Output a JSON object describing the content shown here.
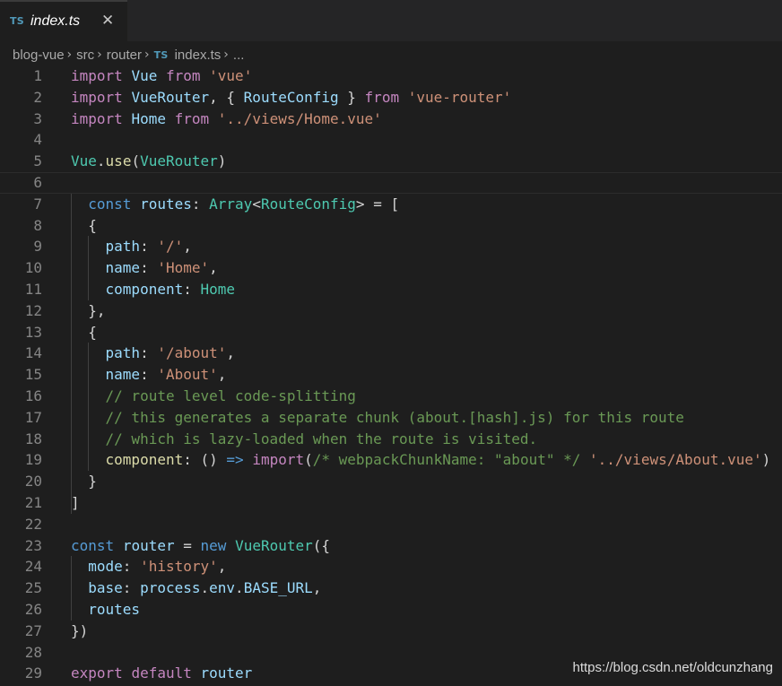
{
  "tab": {
    "language_badge": "TS",
    "title": "index.ts",
    "close_glyph": "✕"
  },
  "breadcrumb": {
    "items": [
      "blog-vue",
      "src",
      "router"
    ],
    "file_badge": "TS",
    "file": "index.ts",
    "ellipsis": "...",
    "separator": "›"
  },
  "editor": {
    "current_line": 6,
    "lines": [
      {
        "n": "1",
        "tokens": [
          [
            "k",
            "import"
          ],
          [
            "p",
            " "
          ],
          [
            "v",
            "Vue"
          ],
          [
            "p",
            " "
          ],
          [
            "k",
            "from"
          ],
          [
            "p",
            " "
          ],
          [
            "s",
            "'vue'"
          ]
        ]
      },
      {
        "n": "2",
        "tokens": [
          [
            "k",
            "import"
          ],
          [
            "p",
            " "
          ],
          [
            "v",
            "VueRouter"
          ],
          [
            "p",
            ", { "
          ],
          [
            "v",
            "RouteConfig"
          ],
          [
            "p",
            " } "
          ],
          [
            "k",
            "from"
          ],
          [
            "p",
            " "
          ],
          [
            "s",
            "'vue-router'"
          ]
        ]
      },
      {
        "n": "3",
        "tokens": [
          [
            "k",
            "import"
          ],
          [
            "p",
            " "
          ],
          [
            "v",
            "Home"
          ],
          [
            "p",
            " "
          ],
          [
            "k",
            "from"
          ],
          [
            "p",
            " "
          ],
          [
            "s",
            "'../views/Home.vue'"
          ]
        ]
      },
      {
        "n": "4",
        "tokens": []
      },
      {
        "n": "5",
        "tokens": [
          [
            "t",
            "Vue"
          ],
          [
            "p",
            "."
          ],
          [
            "f",
            "use"
          ],
          [
            "p",
            "("
          ],
          [
            "t",
            "VueRouter"
          ],
          [
            "p",
            ")"
          ]
        ]
      },
      {
        "n": "6",
        "tokens": []
      },
      {
        "n": "7",
        "tokens": [
          [
            "p",
            "  "
          ],
          [
            "b",
            "const"
          ],
          [
            "p",
            " "
          ],
          [
            "v",
            "routes"
          ],
          [
            "p",
            ": "
          ],
          [
            "t",
            "Array"
          ],
          [
            "p",
            "<"
          ],
          [
            "t",
            "RouteConfig"
          ],
          [
            "p",
            "> = ["
          ]
        ]
      },
      {
        "n": "8",
        "tokens": [
          [
            "p",
            "  {"
          ]
        ]
      },
      {
        "n": "9",
        "tokens": [
          [
            "p",
            "    "
          ],
          [
            "v",
            "path"
          ],
          [
            "p",
            ": "
          ],
          [
            "s",
            "'/'"
          ],
          [
            "p",
            ","
          ]
        ]
      },
      {
        "n": "10",
        "tokens": [
          [
            "p",
            "    "
          ],
          [
            "v",
            "name"
          ],
          [
            "p",
            ": "
          ],
          [
            "s",
            "'Home'"
          ],
          [
            "p",
            ","
          ]
        ]
      },
      {
        "n": "11",
        "tokens": [
          [
            "p",
            "    "
          ],
          [
            "v",
            "component"
          ],
          [
            "p",
            ": "
          ],
          [
            "t",
            "Home"
          ]
        ]
      },
      {
        "n": "12",
        "tokens": [
          [
            "p",
            "  },"
          ]
        ]
      },
      {
        "n": "13",
        "tokens": [
          [
            "p",
            "  {"
          ]
        ]
      },
      {
        "n": "14",
        "tokens": [
          [
            "p",
            "    "
          ],
          [
            "v",
            "path"
          ],
          [
            "p",
            ": "
          ],
          [
            "s",
            "'/about'"
          ],
          [
            "p",
            ","
          ]
        ]
      },
      {
        "n": "15",
        "tokens": [
          [
            "p",
            "    "
          ],
          [
            "v",
            "name"
          ],
          [
            "p",
            ": "
          ],
          [
            "s",
            "'About'"
          ],
          [
            "p",
            ","
          ]
        ]
      },
      {
        "n": "16",
        "tokens": [
          [
            "p",
            "    "
          ],
          [
            "c",
            "// route level code-splitting"
          ]
        ]
      },
      {
        "n": "17",
        "tokens": [
          [
            "p",
            "    "
          ],
          [
            "c",
            "// this generates a separate chunk (about.[hash].js) for this route"
          ]
        ]
      },
      {
        "n": "18",
        "tokens": [
          [
            "p",
            "    "
          ],
          [
            "c",
            "// which is lazy-loaded when the route is visited."
          ]
        ]
      },
      {
        "n": "19",
        "tokens": [
          [
            "p",
            "    "
          ],
          [
            "f",
            "component"
          ],
          [
            "p",
            ": () "
          ],
          [
            "b",
            "=>"
          ],
          [
            "p",
            " "
          ],
          [
            "k",
            "import"
          ],
          [
            "p",
            "("
          ],
          [
            "c",
            "/* webpackChunkName: \"about\" */"
          ],
          [
            "p",
            " "
          ],
          [
            "s",
            "'../views/About.vue'"
          ],
          [
            "p",
            ")"
          ]
        ]
      },
      {
        "n": "20",
        "tokens": [
          [
            "p",
            "  }"
          ]
        ]
      },
      {
        "n": "21",
        "tokens": [
          [
            "p",
            "]"
          ]
        ]
      },
      {
        "n": "22",
        "tokens": []
      },
      {
        "n": "23",
        "tokens": [
          [
            "b",
            "const"
          ],
          [
            "p",
            " "
          ],
          [
            "v",
            "router"
          ],
          [
            "p",
            " = "
          ],
          [
            "b",
            "new"
          ],
          [
            "p",
            " "
          ],
          [
            "t",
            "VueRouter"
          ],
          [
            "p",
            "({"
          ]
        ]
      },
      {
        "n": "24",
        "tokens": [
          [
            "p",
            "  "
          ],
          [
            "v",
            "mode"
          ],
          [
            "p",
            ": "
          ],
          [
            "s",
            "'history'"
          ],
          [
            "p",
            ","
          ]
        ]
      },
      {
        "n": "25",
        "tokens": [
          [
            "p",
            "  "
          ],
          [
            "v",
            "base"
          ],
          [
            "p",
            ": "
          ],
          [
            "v",
            "process"
          ],
          [
            "p",
            "."
          ],
          [
            "v",
            "env"
          ],
          [
            "p",
            "."
          ],
          [
            "v",
            "BASE_URL"
          ],
          [
            "p",
            ","
          ]
        ]
      },
      {
        "n": "26",
        "tokens": [
          [
            "p",
            "  "
          ],
          [
            "v",
            "routes"
          ]
        ]
      },
      {
        "n": "27",
        "tokens": [
          [
            "p",
            "})"
          ]
        ]
      },
      {
        "n": "28",
        "tokens": []
      },
      {
        "n": "29",
        "tokens": [
          [
            "k",
            "export"
          ],
          [
            "p",
            " "
          ],
          [
            "k",
            "default"
          ],
          [
            "p",
            " "
          ],
          [
            "v",
            "router"
          ]
        ]
      }
    ]
  },
  "watermark": "https://blog.csdn.net/oldcunzhang"
}
